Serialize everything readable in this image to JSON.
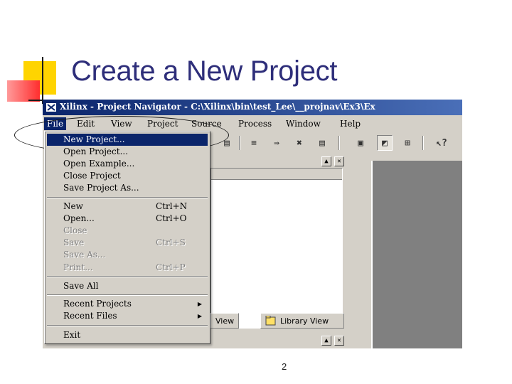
{
  "slide": {
    "title": "Create a New Project",
    "page_number": "2"
  },
  "window": {
    "title": "Xilinx - Project Navigator - C:\\Xilinx\\bin\\test_Lee\\__projnav\\Ex3\\Ex",
    "colors": {
      "titlebar": "#0a246a",
      "highlight": "#0a246a",
      "face": "#d4d0c8"
    }
  },
  "menubar": [
    {
      "label": "File",
      "active": true
    },
    {
      "label": "Edit"
    },
    {
      "label": "View"
    },
    {
      "label": "Project"
    },
    {
      "label": "Source"
    },
    {
      "label": "Process"
    },
    {
      "label": "Window"
    },
    {
      "label": "Help"
    }
  ],
  "file_menu": {
    "items": [
      {
        "label": "New Project...",
        "selected": true
      },
      {
        "label": "Open Project..."
      },
      {
        "label": "Open Example..."
      },
      {
        "label": "Close Project"
      },
      {
        "label": "Save Project As..."
      },
      {
        "label": "New",
        "accel": "Ctrl+N"
      },
      {
        "label": "Open...",
        "accel": "Ctrl+O"
      },
      {
        "label": "Close",
        "disabled": true
      },
      {
        "label": "Save",
        "accel": "Ctrl+S",
        "disabled": true
      },
      {
        "label": "Save As...",
        "disabled": true
      },
      {
        "label": "Print...",
        "accel": "Ctrl+P",
        "disabled": true
      },
      {
        "label": "Save All"
      },
      {
        "label": "Recent Projects",
        "submenu": true
      },
      {
        "label": "Recent Files",
        "submenu": true
      },
      {
        "label": "Exit"
      }
    ]
  },
  "tabs": [
    {
      "label": "View"
    },
    {
      "label": "Library View"
    }
  ],
  "icons": [
    "app-icon",
    "text-align-icon",
    "bookmark-next-icon",
    "clear-bookmarks-icon",
    "list-icon",
    "add-source-icon",
    "schematic-icon",
    "hierarchy-icon",
    "help-pointer-icon"
  ]
}
